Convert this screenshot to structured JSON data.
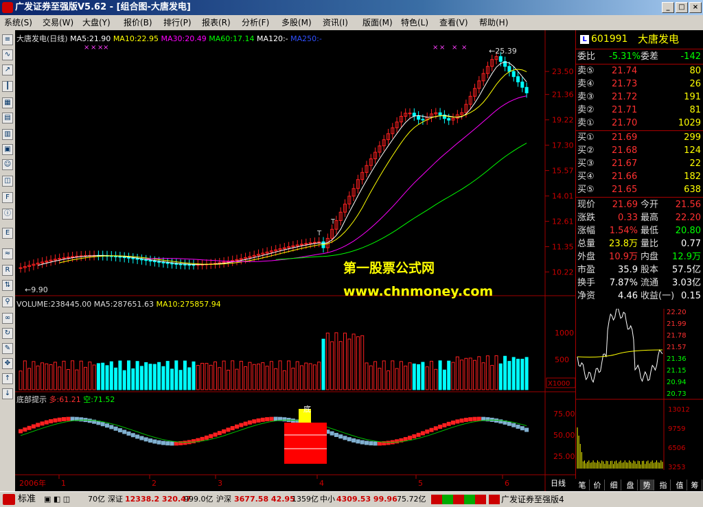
{
  "window": {
    "title": "广发证券至强版V5.62 - [组合图-大唐发电]"
  },
  "menu": [
    "系统(S)",
    "交易(W)",
    "大盘(Y)",
    "报价(B)",
    "排行(P)",
    "报表(R)",
    "分析(F)",
    "多股(M)",
    "资讯(I)",
    "版面(M)",
    "特色(L)",
    "查看(V)",
    "帮助(H)"
  ],
  "main_chart": {
    "title": "大唐发电(日线)",
    "ma_labels": [
      {
        "text": "MA5:21.90",
        "color": "#ffffff"
      },
      {
        "text": "MA10:22.95",
        "color": "#ffff00"
      },
      {
        "text": "MA30:20.49",
        "color": "#ff00ff"
      },
      {
        "text": "MA60:17.14",
        "color": "#00ff00"
      },
      {
        "text": "MA120:-",
        "color": "#ffffff"
      },
      {
        "text": "MA250:-",
        "color": "#0000ff"
      }
    ],
    "y_ticks": [
      "23.50",
      "21.36",
      "19.22",
      "17.30",
      "15.57",
      "14.01",
      "12.61",
      "11.35",
      "10.22"
    ],
    "high_label": "25.39",
    "low_label": "9.90",
    "watermark_cn": "第一股票公式网",
    "watermark_url": "www.chnmoney.com",
    "t_markers": [
      "T",
      "T"
    ]
  },
  "volume": {
    "label": "VOLUME:238445.00",
    "ma5": "MA5:287651.63",
    "ma10": "MA10:275857.94",
    "y_ticks": [
      "1000",
      "500"
    ],
    "unit": "X1000"
  },
  "bottom_indicator": {
    "name": "底部提示",
    "duo": "多:61.21",
    "kong": "空:71.52",
    "y_ticks": [
      "75.00",
      "50.00",
      "25.00"
    ],
    "signal": "底"
  },
  "x_axis": {
    "year": "2006年",
    "months": [
      "1",
      "2",
      "3",
      "4",
      "5",
      "6"
    ]
  },
  "quote": {
    "code": "601991",
    "name": "大唐发电",
    "weibi_label": "委比",
    "weibi": "-5.31%",
    "weicha_label": "委差",
    "weicha": "-142",
    "sells": [
      {
        "label": "卖⑤",
        "price": "21.74",
        "vol": "80"
      },
      {
        "label": "卖④",
        "price": "21.73",
        "vol": "26"
      },
      {
        "label": "卖③",
        "price": "21.72",
        "vol": "191"
      },
      {
        "label": "卖②",
        "price": "21.71",
        "vol": "81"
      },
      {
        "label": "卖①",
        "price": "21.70",
        "vol": "1029"
      }
    ],
    "buys": [
      {
        "label": "买①",
        "price": "21.69",
        "vol": "299"
      },
      {
        "label": "买②",
        "price": "21.68",
        "vol": "124"
      },
      {
        "label": "买③",
        "price": "21.67",
        "vol": "22"
      },
      {
        "label": "买④",
        "price": "21.66",
        "vol": "182"
      },
      {
        "label": "买⑤",
        "price": "21.65",
        "vol": "638"
      }
    ],
    "stats": [
      {
        "l1": "现价",
        "v1": "21.69",
        "c1": "#ff3030",
        "l2": "今开",
        "v2": "21.56",
        "c2": "#ff3030"
      },
      {
        "l1": "涨跌",
        "v1": "0.33",
        "c1": "#ff3030",
        "l2": "最高",
        "v2": "22.20",
        "c2": "#ff3030"
      },
      {
        "l1": "涨幅",
        "v1": "1.54%",
        "c1": "#ff3030",
        "l2": "最低",
        "v2": "20.80",
        "c2": "#00ff00"
      },
      {
        "l1": "总量",
        "v1": "23.8万",
        "c1": "#ffff00",
        "l2": "量比",
        "v2": "0.77",
        "c2": "#ffffff"
      },
      {
        "l1": "外盘",
        "v1": "10.9万",
        "c1": "#ff3030",
        "l2": "内盘",
        "v2": "12.9万",
        "c2": "#00ff00"
      },
      {
        "l1": "市盈",
        "v1": "35.9",
        "c1": "#ffffff",
        "l2": "股本",
        "v2": "57.5亿",
        "c2": "#ffffff"
      },
      {
        "l1": "换手",
        "v1": "7.87%",
        "c1": "#ffffff",
        "l2": "流通",
        "v2": "3.03亿",
        "c2": "#ffffff"
      },
      {
        "l1": "净资",
        "v1": "4.46",
        "c1": "#ffffff",
        "l2": "收益(一)",
        "v2": "0.15",
        "c2": "#ffffff"
      }
    ],
    "mini_ticks": [
      "22.20",
      "21.99",
      "21.78",
      "21.57",
      "21.36",
      "21.15",
      "20.94",
      "20.73"
    ],
    "mini_vol_ticks": [
      "13012",
      "9759",
      "6506",
      "3253"
    ]
  },
  "tabs": [
    "笔",
    "价",
    "细",
    "盘",
    "势",
    "指",
    "值",
    "筹"
  ],
  "period": "日线",
  "status": {
    "std": "标准",
    "sh": "70亿",
    "sz_label": "深证",
    "sz": "12338.2 320.47",
    "sz_amt": "999.0亿",
    "hs_label": "沪深",
    "hs": "3677.58  42.95",
    "hs_amt": "1359亿",
    "zx_label": "中小",
    "zx": "4309.53  99.96",
    "zx_amt": "75.72亿",
    "app": "广发证券至强版4"
  },
  "colors": {
    "up": "#ff2020",
    "down": "#00ffff",
    "ma5": "#ffffff",
    "ma10": "#ffff00",
    "ma30": "#ff00ff",
    "ma60": "#00ff00",
    "axis": "#a00000"
  }
}
